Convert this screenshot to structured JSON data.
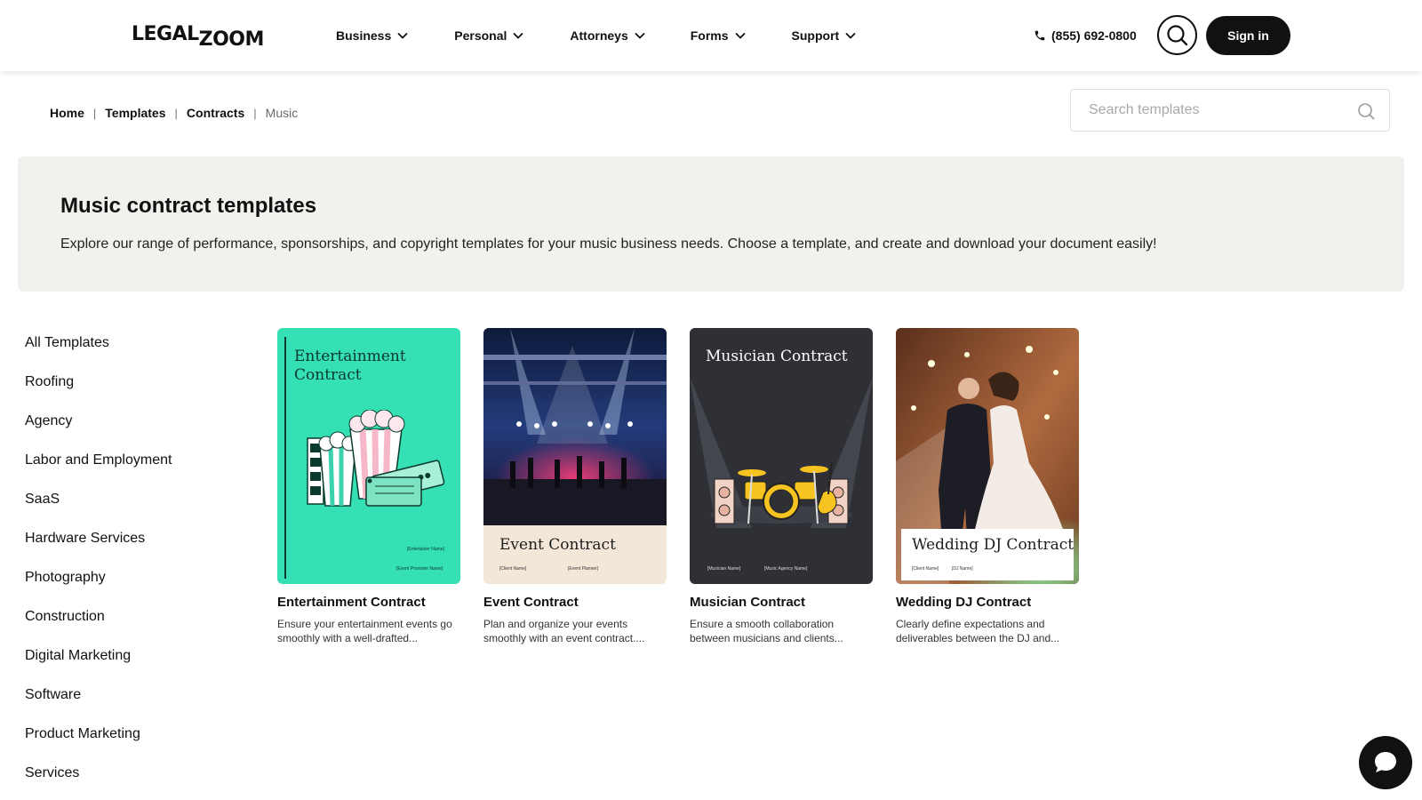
{
  "header": {
    "logo_left": "LEGAL",
    "logo_right": "ZOOM",
    "nav": [
      {
        "label": "Business",
        "icon": "chevron-down-icon"
      },
      {
        "label": "Personal",
        "icon": "chevron-down-icon"
      },
      {
        "label": "Attorneys",
        "icon": "chevron-down-icon"
      },
      {
        "label": "Forms",
        "icon": "chevron-down-icon"
      },
      {
        "label": "Support",
        "icon": "chevron-down-icon"
      }
    ],
    "phone": "(855) 692-0800",
    "signin": "Sign in"
  },
  "breadcrumb": {
    "items": [
      "Home",
      "Templates",
      "Contracts"
    ],
    "current": "Music",
    "separator": "|"
  },
  "search": {
    "placeholder": "Search templates"
  },
  "hero": {
    "title": "Music contract templates",
    "description": "Explore our range of performance, sponsorships, and copyright templates for your music business needs. Choose a template, and create and download your document easily!"
  },
  "sidebar": {
    "items": [
      "All Templates",
      "Roofing",
      "Agency",
      "Labor and Employment",
      "SaaS",
      "Hardware Services",
      "Photography",
      "Construction",
      "Digital Marketing",
      "Software",
      "Product Marketing",
      "Services"
    ]
  },
  "cards": [
    {
      "thumb_title_1": "Entertainment",
      "thumb_title_2": "Contract",
      "field_1": "[Entertainer Name]",
      "field_2": "[Event Promoter Name]",
      "title": "Entertainment Contract",
      "description": "Ensure your entertainment events go smoothly with a well-drafted..."
    },
    {
      "thumb_title": "Event Contract",
      "field_1": "[Client Name]",
      "field_2": "[Event Planner]",
      "title": "Event Contract",
      "description": "Plan and organize your events smoothly with an event contract...."
    },
    {
      "thumb_title": "Musician Contract",
      "field_1": "[Musician Name]",
      "field_2": "[Music Agency Name]",
      "title": "Musician Contract",
      "description": "Ensure a smooth collaboration between musicians and clients..."
    },
    {
      "thumb_title": "Wedding DJ Contract",
      "field_1": "[Client Name]",
      "field_2": "[DJ Name]",
      "title": "Wedding DJ Contract",
      "description": "Clearly define expectations and deliverables between the DJ and..."
    }
  ],
  "colors": {
    "accent": "#111111",
    "hero_bg": "#f3f1ed",
    "card1_bg": "#35e0b4",
    "card3_bg": "#2f3036",
    "card2_footer": "#f3e7da"
  }
}
